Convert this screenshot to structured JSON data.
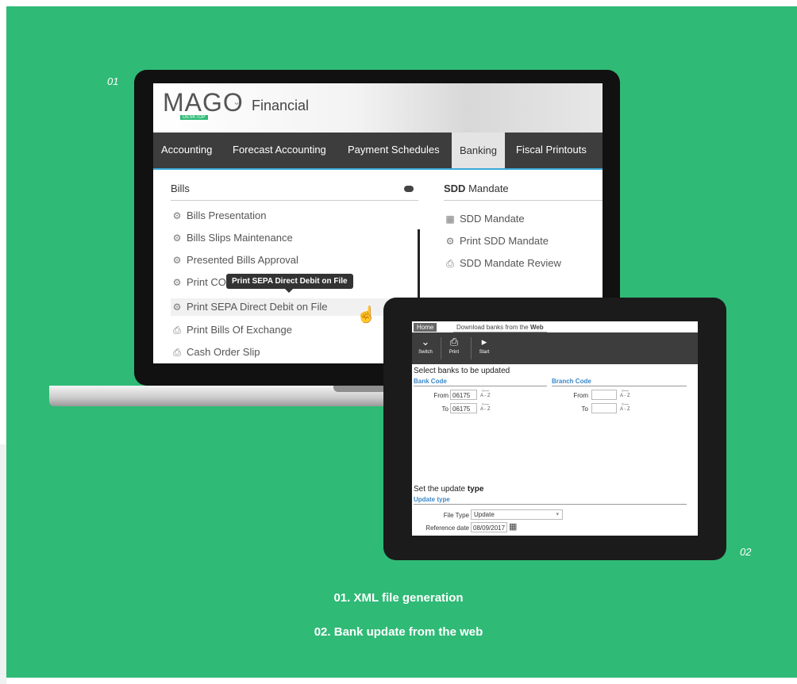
{
  "labels": {
    "n1": "01",
    "n2": "02"
  },
  "captions": {
    "c1": "01. XML file generation",
    "c2": "02. Bank update from the web"
  },
  "colors": {
    "brand_green": "#2fba76",
    "nav_dark": "#3d3d3d",
    "accent_blue": "#3aa9d6"
  },
  "app": {
    "logo": "MAGO",
    "logo_sub": "DESKTOP",
    "module": "Financial",
    "nav": [
      "Accounting",
      "Forecast Accounting",
      "Payment Schedules",
      "Banking",
      "Fiscal Printouts"
    ],
    "active_nav": "Banking",
    "bills": {
      "title": "Bills",
      "items": [
        {
          "icon": "gears-icon",
          "label": "Bills Presentation"
        },
        {
          "icon": "gears-icon",
          "label": "Bills Slips Maintenance"
        },
        {
          "icon": "gears-icon",
          "label": "Presented Bills Approval"
        },
        {
          "icon": "gears-icon",
          "label": "Print CO"
        },
        {
          "icon": "gears-icon",
          "label": "Print SEPA Direct Debit on File"
        },
        {
          "icon": "printer-icon",
          "label": "Print Bills Of Exchange"
        },
        {
          "icon": "printer-icon",
          "label": "Cash Order Slip"
        }
      ],
      "tooltip": "Print SEPA Direct Debit on File"
    },
    "sdd": {
      "title_bold": "SDD",
      "title_rest": " Mandate",
      "items": [
        {
          "icon": "grid-form-icon",
          "label": "SDD Mandate"
        },
        {
          "icon": "gears-icon",
          "label": "Print SDD Mandate"
        },
        {
          "icon": "printer-icon",
          "label": "SDD Mandate Review"
        }
      ]
    }
  },
  "tablet": {
    "tabs": {
      "home": "Home",
      "download_prefix": "Download banks from the ",
      "download_bold": "Web"
    },
    "toolbar": {
      "switch": "Switch",
      "print": "Print",
      "start": "Start"
    },
    "select_title": "Select banks to be updated",
    "bank_code": "Bank Code",
    "branch_code": "Branch Code",
    "from": "From",
    "to": "To",
    "bank_from": "06175",
    "bank_to": "06175",
    "az": "A - Z",
    "update_title_prefix": "Set the update ",
    "update_title_bold": "type",
    "update_type": "Update type",
    "file_type_label": "File Type",
    "file_type_value": "Update",
    "reference_date_label": "Reference date",
    "reference_date_value": "08/09/2017"
  }
}
